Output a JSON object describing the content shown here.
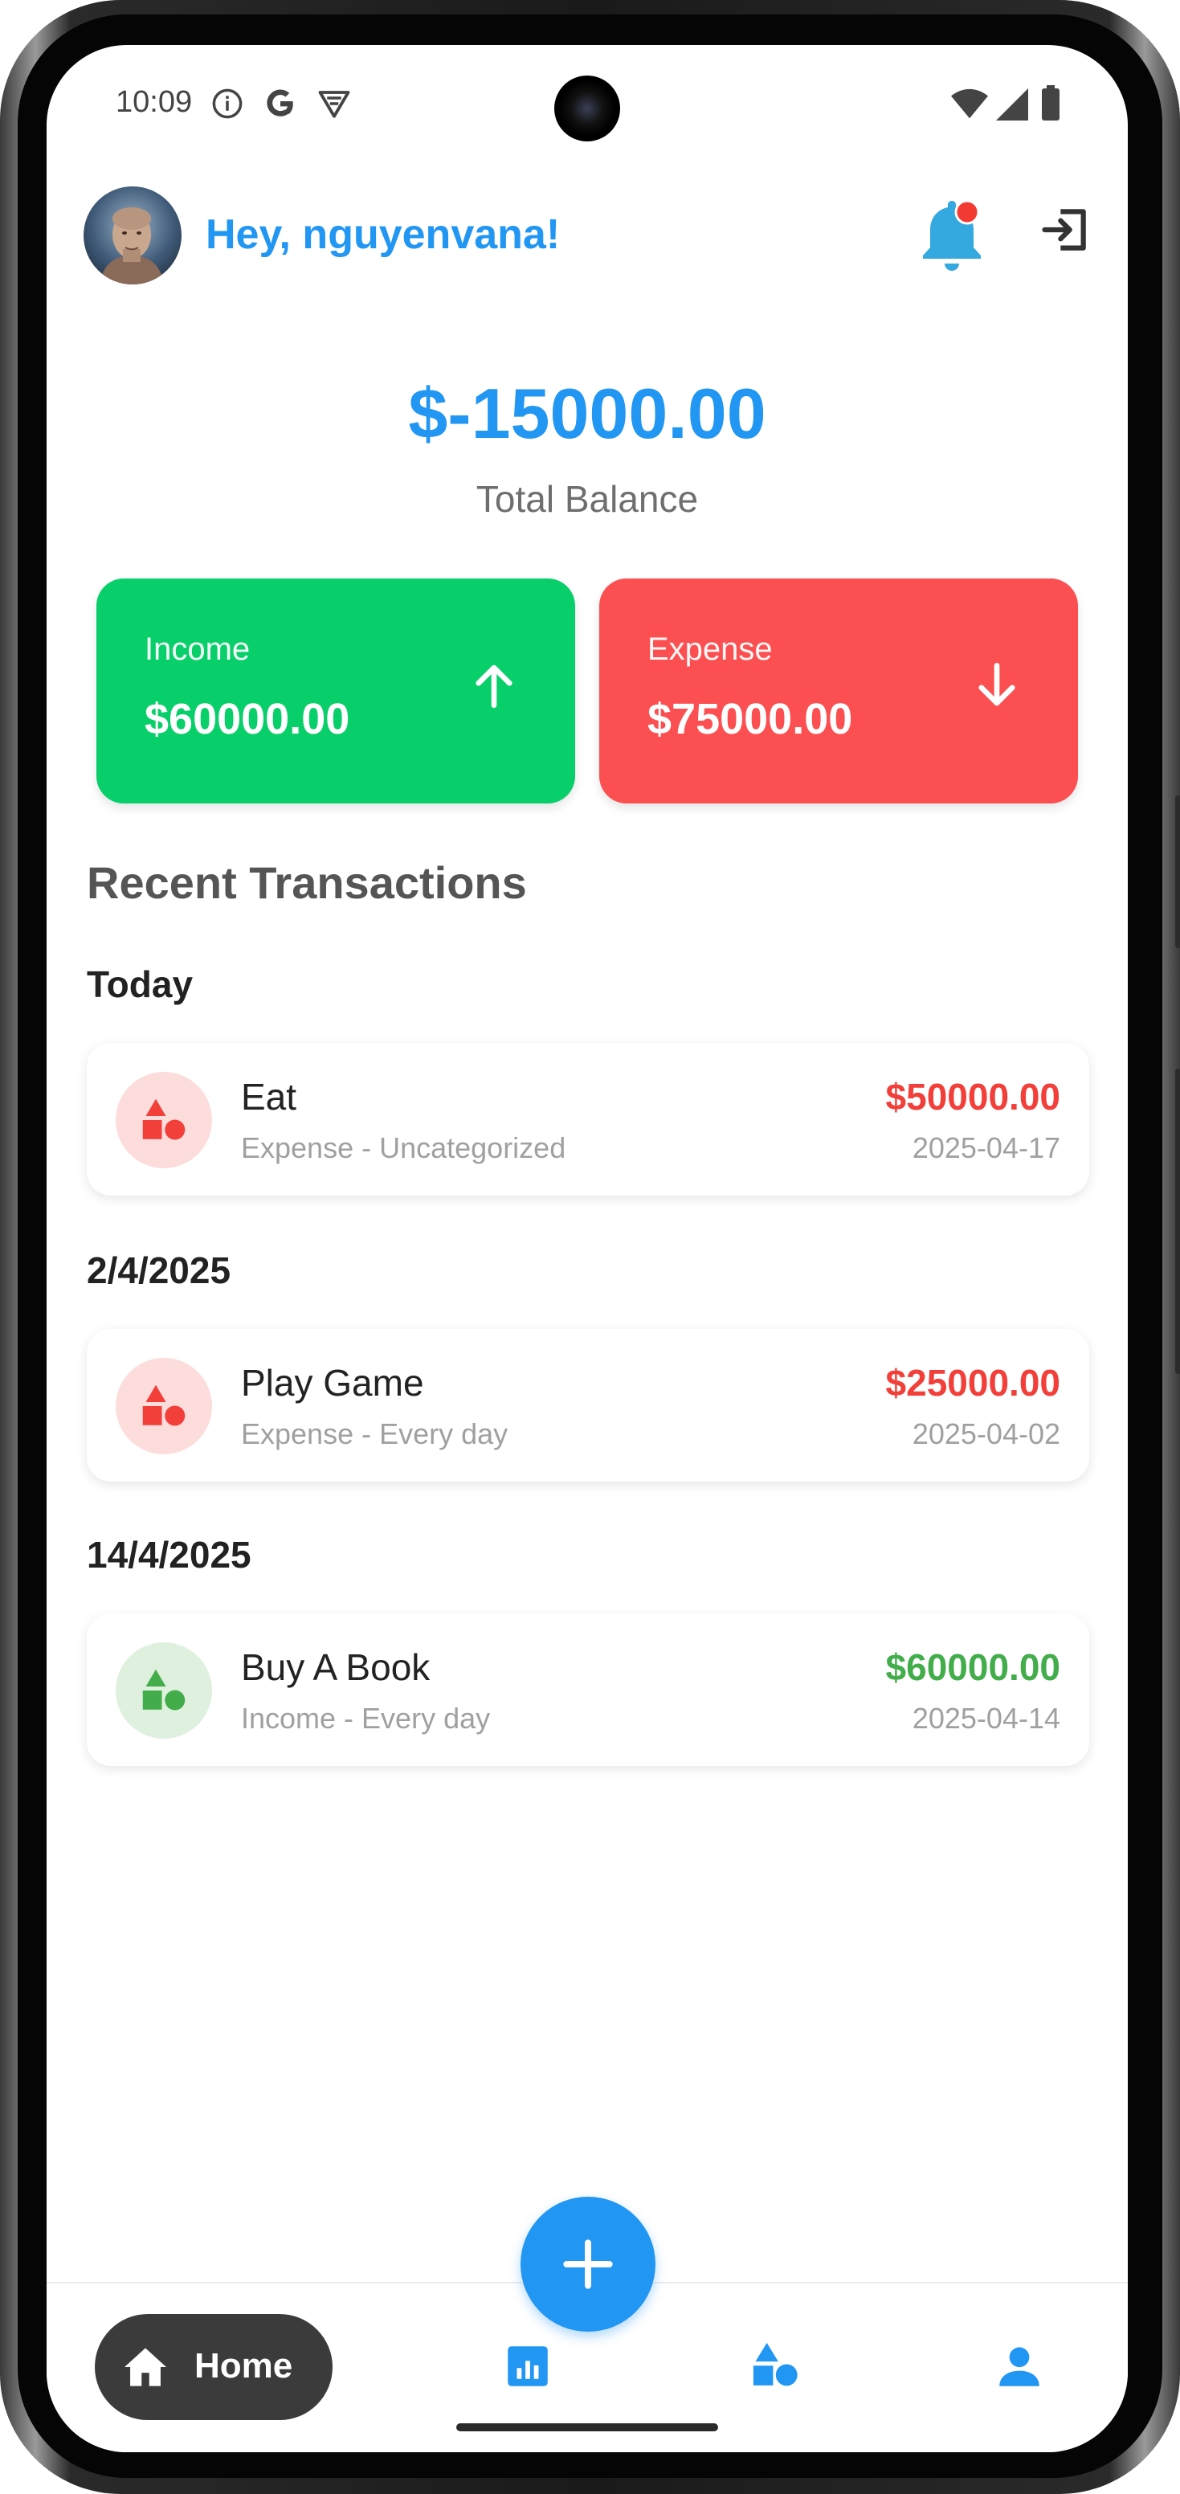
{
  "status_bar": {
    "time": "10:09",
    "icons": [
      "info-icon",
      "google-icon",
      "vpn-icon",
      "wifi-icon",
      "signal-icon",
      "battery-icon"
    ]
  },
  "header": {
    "greeting": "Hey, nguyenvana!",
    "avatar_icon": "user-avatar",
    "notification_icon": "bell-icon",
    "logout_icon": "logout-icon"
  },
  "balance": {
    "value": "$-15000.00",
    "label": "Total Balance"
  },
  "summary": {
    "income": {
      "label": "Income",
      "amount": "$60000.00",
      "icon": "arrow-up-icon",
      "color": "#09cf6b"
    },
    "expense": {
      "label": "Expense",
      "amount": "$75000.00",
      "icon": "arrow-down-icon",
      "color": "#fc4f51"
    }
  },
  "transactions": {
    "title": "Recent Transactions",
    "groups": [
      {
        "date": "Today",
        "items": [
          {
            "title": "Eat",
            "subtitle": "Expense - Uncategorized",
            "amount": "$50000.00",
            "date": "2025-04-17",
            "type": "expense"
          }
        ]
      },
      {
        "date": "2/4/2025",
        "items": [
          {
            "title": "Play Game",
            "subtitle": "Expense - Every day",
            "amount": "$25000.00",
            "date": "2025-04-02",
            "type": "expense"
          }
        ]
      },
      {
        "date": "14/4/2025",
        "items": [
          {
            "title": "Buy A Book",
            "subtitle": "Income - Every day",
            "amount": "$60000.00",
            "date": "2025-04-14",
            "type": "income"
          }
        ]
      }
    ]
  },
  "bottom_nav": {
    "home_label": "Home",
    "items": [
      "home-icon",
      "stats-icon",
      "categories-icon",
      "profile-icon"
    ],
    "fab_icon": "plus-icon"
  },
  "colors": {
    "primary": "#2196f3",
    "income": "#42ad4a",
    "expense": "#f23f3a"
  }
}
